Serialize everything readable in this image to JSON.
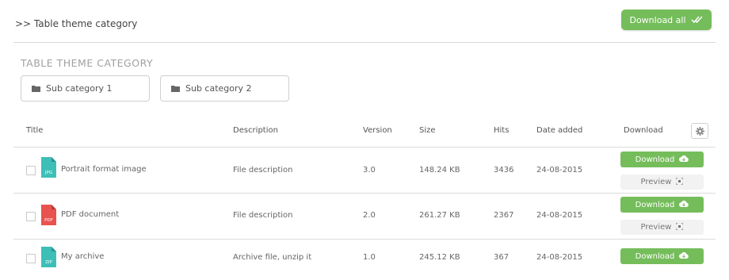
{
  "header": {
    "breadcrumb": ">> Table theme category",
    "download_all_label": "Download all"
  },
  "category": {
    "title": "TABLE THEME CATEGORY",
    "subcategories": [
      "Sub category 1",
      "Sub category 2"
    ]
  },
  "table": {
    "columns": [
      "Title",
      "Description",
      "Version",
      "Size",
      "Hits",
      "Date added",
      "Download"
    ],
    "rows": [
      {
        "ext": "JPG",
        "title": "Portrait format image",
        "description": "File description",
        "version": "3.0",
        "size": "148.24 KB",
        "hits": "3436",
        "date": "24-08-2015",
        "download_label": "Download",
        "preview_label": "Preview",
        "icon_color": "#3dbfb8"
      },
      {
        "ext": "PDF",
        "title": "PDF document",
        "description": "File description",
        "version": "2.0",
        "size": "261.27 KB",
        "hits": "2367",
        "date": "24-08-2015",
        "download_label": "Download",
        "preview_label": "Preview",
        "icon_color": "#e8534f"
      },
      {
        "ext": "ZIP",
        "title": "My archive",
        "description": "Archive file, unzip it",
        "version": "1.0",
        "size": "245.12 KB",
        "hits": "367",
        "date": "24-08-2015",
        "download_label": "Download",
        "icon_color": "#3dbfb8"
      }
    ]
  },
  "colors": {
    "accent": "#75bd5b"
  }
}
